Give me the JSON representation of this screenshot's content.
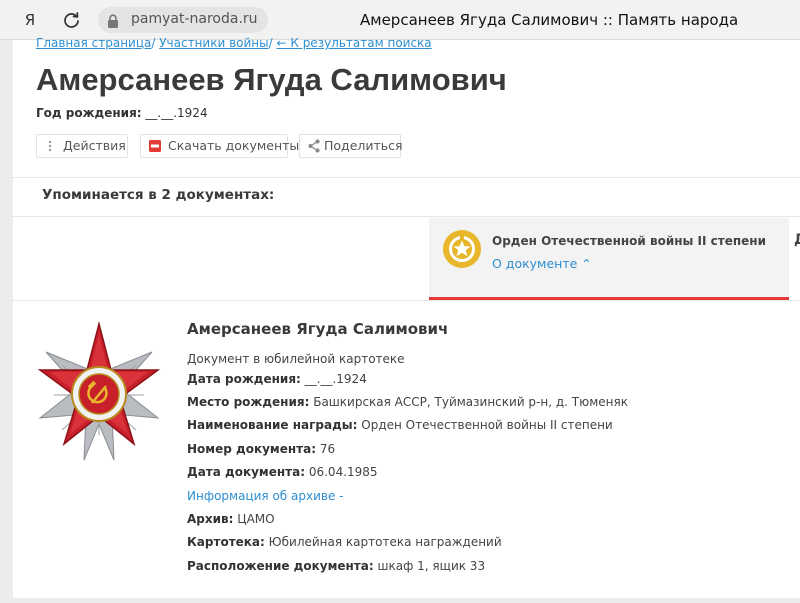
{
  "browser": {
    "yandex_label": "Я",
    "url": "pamyat-naroda.ru",
    "tab_title": "Амерсанеев Ягуда Салимович :: Память народа"
  },
  "breadcrumb": {
    "home": "Главная страница",
    "participants": "Участники войны",
    "back": "← К результатам поиска"
  },
  "person": {
    "name": "Амерсанеев Ягуда Салимович",
    "birth_label": "Год рождения:",
    "birth_value": "__.__.1924"
  },
  "actions": {
    "actions_label": "Действия",
    "download_label": "Скачать документы",
    "share_label": "Поделиться"
  },
  "mentions_title": "Упоминается в 2 документах:",
  "doc_tab": {
    "title": "Орден Отечественной войны II степени",
    "link": "О документе ⌃",
    "next_initial": "Д"
  },
  "document": {
    "name": "Амерсанеев Ягуда Салимович",
    "type": "Документ в юбилейной картотеке",
    "fields": [
      {
        "label": "Дата рождения:",
        "value": "__.__.1924"
      },
      {
        "label": "Место рождения:",
        "value": "Башкирская АССР, Туймазинский р-н, д. Тюменяк"
      },
      {
        "label": "Наименование награды:",
        "value": "Орден Отечественной войны II степени"
      },
      {
        "label": "Номер документа:",
        "value": "76"
      },
      {
        "label": "Дата документа:",
        "value": "06.04.1985"
      }
    ],
    "archive_info_link": "Информация об архиве -",
    "archive_fields": [
      {
        "label": "Архив:",
        "value": "ЦАМО"
      },
      {
        "label": "Картотека:",
        "value": "Юбилейная картотека награждений"
      },
      {
        "label": "Расположение документа:",
        "value": "шкаф 1, ящик 33"
      }
    ]
  },
  "colors": {
    "link": "#2d8fd0",
    "accent_red": "#e53935",
    "medal_gold": "#e8b62a"
  }
}
